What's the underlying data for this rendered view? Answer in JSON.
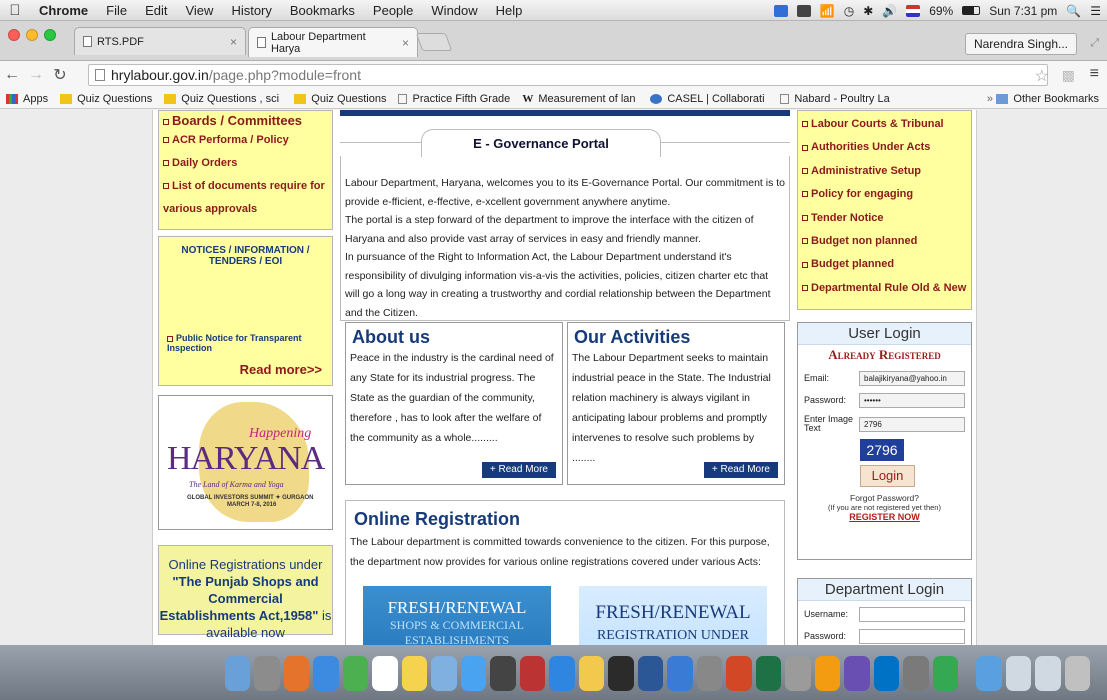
{
  "menubar": {
    "app": "Chrome",
    "items": [
      "File",
      "Edit",
      "View",
      "History",
      "Bookmarks",
      "People",
      "Window",
      "Help"
    ],
    "battery": "69%",
    "clock": "Sun 7:31 pm"
  },
  "tabs": [
    {
      "label": "RTS.PDF"
    },
    {
      "label": "Labour Department Harya"
    }
  ],
  "profile": "Narendra Singh...",
  "address": {
    "host": "hrylabour.gov.in",
    "path": "/page.php?module=front"
  },
  "bookmarks": [
    {
      "label": "Apps",
      "icon": "apps-icon"
    },
    {
      "label": "Quiz Questions",
      "icon": "folder-icon"
    },
    {
      "label": "Quiz Questions , sci",
      "icon": "folder-icon"
    },
    {
      "label": "Quiz Questions",
      "icon": "folder-icon"
    },
    {
      "label": "Practice Fifth Grade",
      "icon": "page-icon"
    },
    {
      "label": "Measurement of lan",
      "icon": "wikipedia-icon"
    },
    {
      "label": "CASEL | Collaborati",
      "icon": "casel-icon"
    },
    {
      "label": "Nabard - Poultry La",
      "icon": "page-icon"
    }
  ],
  "bookmarks_more": "»",
  "other_bookmarks": "Other Bookmarks",
  "left": {
    "links": [
      "Boards / Committees",
      "ACR Performa / Policy",
      "Daily Orders",
      "List of documents require for",
      "various approvals"
    ],
    "notices_title": "NOTICES / INFORMATION / TENDERS / EOI",
    "notice_item": "Public Notice for Transparent Inspection",
    "read_more": "Read more>>",
    "banner": {
      "title": "HARYANA",
      "script": "Happening",
      "tagline": "The Land of Karma and Yoga",
      "summit": "GLOBAL INVESTORS SUMMIT ✦ GURGAON",
      "dates": "MARCH 7-8, 2016"
    },
    "promo_a": "Online Registrations under",
    "promo_b": "\"The Punjab Shops and Commercial Establishments Act,1958\"",
    "promo_c": " is available now"
  },
  "center": {
    "egov_title": "E - Governance Portal",
    "egov_text": "Labour Department, Haryana, welcomes you to its E-Governance Portal. Our commitment is to provide e-fficient, e-ffective, e-xcellent government anywhere anytime.",
    "egov_text2": "The portal is a step forward of the department to improve the interface with the citizen of Haryana and also provide vast array of services in easy and friendly manner.",
    "egov_text3": "In pursuance of the Right to Information Act, the Labour Department understand it's responsibility of divulging information vis-a-vis the activities, policies, citizen charter etc that will go a long way in creating a trustworthy and cordial relationship between the Department and the Citizen.",
    "about_title": "About us",
    "about_text": "Peace in the industry is the cardinal need of any State for its industrial progress. The State as the guardian of the community, therefore , has to look after the welfare of the community as a whole.........",
    "activities_title": "Our Activities",
    "activities_text": "The Labour Department seeks to maintain industrial peace in the State. The Industrial relation machinery is always vigilant in anticipating labour problems and promptly intervenes to resolve such problems by ........",
    "read_more_btn": "+ Read More",
    "online_title": "Online Registration",
    "online_text": "The Labour department is committed towards convenience to the citizen. For this purpose, the department now provides for various online registrations covered under various Acts:",
    "reg1_a": "FRESH/RENEWAL",
    "reg1_b": "SHOPS & COMMERCIAL",
    "reg1_c": "ESTABLISHMENTS",
    "reg2_a": "FRESH/RENEWAL",
    "reg2_b": "REGISTRATION UNDER"
  },
  "right": {
    "links": [
      "Labour Courts & Tribunal",
      "Authorities Under Acts",
      "Administrative Setup",
      "Policy for engaging",
      "Tender Notice",
      "Budget non planned",
      "Budget planned",
      "Departmental Rule Old & New"
    ],
    "login_title": "User Login",
    "already": "Already Registered",
    "email_label": "Email:",
    "email_value": "balajikiryana@yahoo.in",
    "password_label": "Password:",
    "password_value": "••••••",
    "image_label": "Enter Image Text",
    "image_value": "2796",
    "captcha": "2796",
    "login_btn": "Login",
    "forgot": "Forgot Password?",
    "not_registered": "(If you are not registered yet then)",
    "register": "REGISTER NOW",
    "dept_title": "Department Login",
    "username_label": "Username:",
    "dept_password_label": "Password:"
  },
  "dock_icons": [
    "finder-icon",
    "launchpad-icon",
    "firefox-icon",
    "safari-icon",
    "chrome-icon",
    "calendar-icon",
    "notes-icon",
    "preview-icon",
    "messages-icon",
    "facetime-icon",
    "photo-booth-icon",
    "app-store-icon",
    "sketch-icon",
    "stocks-icon",
    "word-icon",
    "keynote-icon",
    "screenshot-icon",
    "powerpoint-icon",
    "excel-icon",
    "settings-icon",
    "photos-icon",
    "imovie-icon",
    "outlook-icon",
    "system-prefs-icon",
    "chrome-2-icon",
    "folder-icon",
    "documents-icon",
    "downloads-icon",
    "trash-icon"
  ]
}
